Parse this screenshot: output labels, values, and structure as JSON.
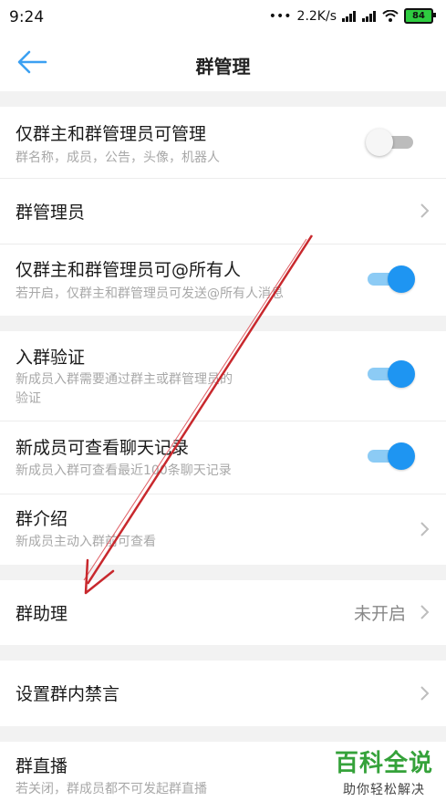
{
  "status": {
    "time": "9:24",
    "speed": "2.2K/s",
    "battery": "84"
  },
  "header": {
    "title": "群管理"
  },
  "settings": {
    "admin_only_manage": {
      "title": "仅群主和群管理员可管理",
      "subtitle": "群名称，成员，公告，头像，机器人",
      "enabled": false
    },
    "admins": {
      "title": "群管理员"
    },
    "admin_only_at_all": {
      "title": "仅群主和群管理员可@所有人",
      "subtitle": "若开启，仅群主和群管理员可发送@所有人消息",
      "enabled": true
    },
    "join_verify": {
      "title": "入群验证",
      "subtitle_line1": "新成员入群需要通过群主或群管理员的",
      "subtitle_line2": "验证",
      "enabled": true
    },
    "new_member_history": {
      "title": "新成员可查看聊天记录",
      "subtitle": "新成员入群可查看最近100条聊天记录",
      "enabled": true
    },
    "group_intro": {
      "title": "群介绍",
      "subtitle": "新成员主动入群前可查看"
    },
    "group_assistant": {
      "title": "群助理",
      "value": "未开启"
    },
    "mute": {
      "title": "设置群内禁言"
    },
    "live": {
      "title": "群直播",
      "subtitle": "若关闭，群成员都不可发起群直播"
    }
  },
  "watermark": {
    "brand": "百科全说",
    "slogan": "助你轻松解决"
  },
  "colors": {
    "accent": "#1e95f2",
    "annotation_arrow": "#c8282d",
    "watermark": "#35a23a"
  }
}
